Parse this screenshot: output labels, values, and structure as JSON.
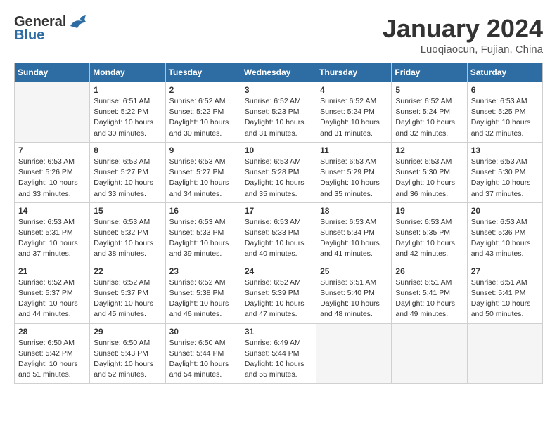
{
  "header": {
    "logo_general": "General",
    "logo_blue": "Blue",
    "month_title": "January 2024",
    "location": "Luoqiaocun, Fujian, China"
  },
  "days_of_week": [
    "Sunday",
    "Monday",
    "Tuesday",
    "Wednesday",
    "Thursday",
    "Friday",
    "Saturday"
  ],
  "weeks": [
    [
      {
        "day": "",
        "info": ""
      },
      {
        "day": "1",
        "info": "Sunrise: 6:51 AM\nSunset: 5:22 PM\nDaylight: 10 hours\nand 30 minutes."
      },
      {
        "day": "2",
        "info": "Sunrise: 6:52 AM\nSunset: 5:22 PM\nDaylight: 10 hours\nand 30 minutes."
      },
      {
        "day": "3",
        "info": "Sunrise: 6:52 AM\nSunset: 5:23 PM\nDaylight: 10 hours\nand 31 minutes."
      },
      {
        "day": "4",
        "info": "Sunrise: 6:52 AM\nSunset: 5:24 PM\nDaylight: 10 hours\nand 31 minutes."
      },
      {
        "day": "5",
        "info": "Sunrise: 6:52 AM\nSunset: 5:24 PM\nDaylight: 10 hours\nand 32 minutes."
      },
      {
        "day": "6",
        "info": "Sunrise: 6:53 AM\nSunset: 5:25 PM\nDaylight: 10 hours\nand 32 minutes."
      }
    ],
    [
      {
        "day": "7",
        "info": "Sunrise: 6:53 AM\nSunset: 5:26 PM\nDaylight: 10 hours\nand 33 minutes."
      },
      {
        "day": "8",
        "info": "Sunrise: 6:53 AM\nSunset: 5:27 PM\nDaylight: 10 hours\nand 33 minutes."
      },
      {
        "day": "9",
        "info": "Sunrise: 6:53 AM\nSunset: 5:27 PM\nDaylight: 10 hours\nand 34 minutes."
      },
      {
        "day": "10",
        "info": "Sunrise: 6:53 AM\nSunset: 5:28 PM\nDaylight: 10 hours\nand 35 minutes."
      },
      {
        "day": "11",
        "info": "Sunrise: 6:53 AM\nSunset: 5:29 PM\nDaylight: 10 hours\nand 35 minutes."
      },
      {
        "day": "12",
        "info": "Sunrise: 6:53 AM\nSunset: 5:30 PM\nDaylight: 10 hours\nand 36 minutes."
      },
      {
        "day": "13",
        "info": "Sunrise: 6:53 AM\nSunset: 5:30 PM\nDaylight: 10 hours\nand 37 minutes."
      }
    ],
    [
      {
        "day": "14",
        "info": "Sunrise: 6:53 AM\nSunset: 5:31 PM\nDaylight: 10 hours\nand 37 minutes."
      },
      {
        "day": "15",
        "info": "Sunrise: 6:53 AM\nSunset: 5:32 PM\nDaylight: 10 hours\nand 38 minutes."
      },
      {
        "day": "16",
        "info": "Sunrise: 6:53 AM\nSunset: 5:33 PM\nDaylight: 10 hours\nand 39 minutes."
      },
      {
        "day": "17",
        "info": "Sunrise: 6:53 AM\nSunset: 5:33 PM\nDaylight: 10 hours\nand 40 minutes."
      },
      {
        "day": "18",
        "info": "Sunrise: 6:53 AM\nSunset: 5:34 PM\nDaylight: 10 hours\nand 41 minutes."
      },
      {
        "day": "19",
        "info": "Sunrise: 6:53 AM\nSunset: 5:35 PM\nDaylight: 10 hours\nand 42 minutes."
      },
      {
        "day": "20",
        "info": "Sunrise: 6:53 AM\nSunset: 5:36 PM\nDaylight: 10 hours\nand 43 minutes."
      }
    ],
    [
      {
        "day": "21",
        "info": "Sunrise: 6:52 AM\nSunset: 5:37 PM\nDaylight: 10 hours\nand 44 minutes."
      },
      {
        "day": "22",
        "info": "Sunrise: 6:52 AM\nSunset: 5:37 PM\nDaylight: 10 hours\nand 45 minutes."
      },
      {
        "day": "23",
        "info": "Sunrise: 6:52 AM\nSunset: 5:38 PM\nDaylight: 10 hours\nand 46 minutes."
      },
      {
        "day": "24",
        "info": "Sunrise: 6:52 AM\nSunset: 5:39 PM\nDaylight: 10 hours\nand 47 minutes."
      },
      {
        "day": "25",
        "info": "Sunrise: 6:51 AM\nSunset: 5:40 PM\nDaylight: 10 hours\nand 48 minutes."
      },
      {
        "day": "26",
        "info": "Sunrise: 6:51 AM\nSunset: 5:41 PM\nDaylight: 10 hours\nand 49 minutes."
      },
      {
        "day": "27",
        "info": "Sunrise: 6:51 AM\nSunset: 5:41 PM\nDaylight: 10 hours\nand 50 minutes."
      }
    ],
    [
      {
        "day": "28",
        "info": "Sunrise: 6:50 AM\nSunset: 5:42 PM\nDaylight: 10 hours\nand 51 minutes."
      },
      {
        "day": "29",
        "info": "Sunrise: 6:50 AM\nSunset: 5:43 PM\nDaylight: 10 hours\nand 52 minutes."
      },
      {
        "day": "30",
        "info": "Sunrise: 6:50 AM\nSunset: 5:44 PM\nDaylight: 10 hours\nand 54 minutes."
      },
      {
        "day": "31",
        "info": "Sunrise: 6:49 AM\nSunset: 5:44 PM\nDaylight: 10 hours\nand 55 minutes."
      },
      {
        "day": "",
        "info": ""
      },
      {
        "day": "",
        "info": ""
      },
      {
        "day": "",
        "info": ""
      }
    ]
  ]
}
